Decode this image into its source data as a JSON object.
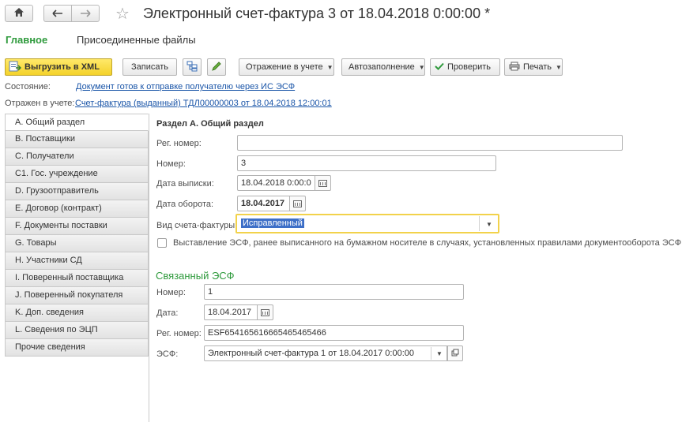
{
  "window": {
    "title": "Электронный счет-фактура 3 от 18.04.2018 0:00:00 *"
  },
  "tabs": [
    {
      "label": "Главное"
    },
    {
      "label": "Присоединенные файлы"
    }
  ],
  "toolbar": {
    "export_xml": "Выгрузить в XML",
    "save": "Записать",
    "reflection": "Отражение в учете",
    "autofill": "Автозаполнение",
    "check": "Проверить",
    "print": "Печать"
  },
  "status": {
    "state_label": "Состояние:",
    "state_link": "Документ готов к отправке получателю через ИС ЭСФ",
    "reflected_label": "Отражен в учете:",
    "reflected_link": "Счет-фактура (выданный) ТДЛ00000003 от 18.04.2018 12:00:01"
  },
  "sidebar": {
    "items": [
      {
        "label": "A. Общий раздел"
      },
      {
        "label": "B. Поставщики"
      },
      {
        "label": "C. Получатели"
      },
      {
        "label": "C1. Гос. учреждение"
      },
      {
        "label": "D. Грузоотправитель"
      },
      {
        "label": "E. Договор (контракт)"
      },
      {
        "label": "F. Документы поставки"
      },
      {
        "label": "G. Товары"
      },
      {
        "label": "H. Участники СД"
      },
      {
        "label": "I. Поверенный поставщика"
      },
      {
        "label": "J. Поверенный покупателя"
      },
      {
        "label": "K. Доп. сведения"
      },
      {
        "label": "L. Сведения по ЭЦП"
      },
      {
        "label": "Прочие сведения"
      }
    ]
  },
  "section_a": {
    "title": "Раздел A. Общий раздел",
    "reg_number_label": "Рег. номер:",
    "reg_number_value": "",
    "number_label": "Номер:",
    "number_value": "3",
    "issue_date_label": "Дата выписки:",
    "issue_date_value": "18.04.2018  0:00:0",
    "turnover_date_label": "Дата оборота:",
    "turnover_date_value": "18.04.2017",
    "invoice_type_label": "Вид счета-фактуры:",
    "invoice_type_value": "Исправленный",
    "paper_checkbox_label": "Выставление ЭСФ, ранее выписанного на бумажном носителе в случаях, установленных правилами документооборота ЭСФ"
  },
  "related": {
    "title": "Связанный ЭСФ",
    "number_label": "Номер:",
    "number_value": "1",
    "date_label": "Дата:",
    "date_value": "18.04.2017",
    "reg_number_label": "Рег. номер:",
    "reg_number_value": "ESF654165616665465465466",
    "esf_label": "ЭСФ:",
    "esf_value": "Электронный счет-фактура 1 от 18.04.2017 0:00:00"
  },
  "colors": {
    "accent_green": "#2e9a3c",
    "link_blue": "#1a55a8",
    "primary_yellow": "#f4d22a",
    "focus_yellow": "#f2d24b",
    "selection_blue": "#3d6fc7"
  }
}
